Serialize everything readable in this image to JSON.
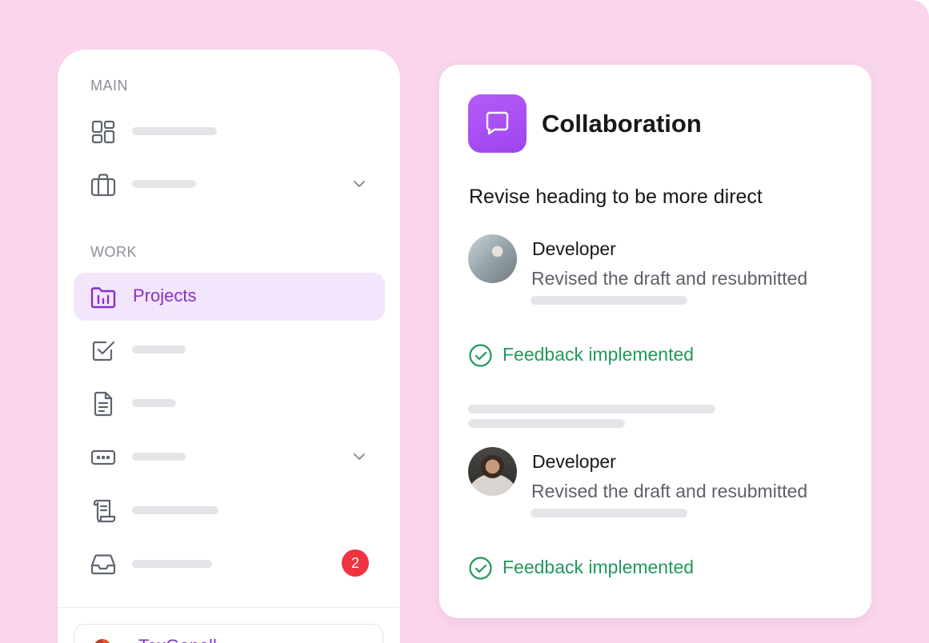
{
  "sidebar": {
    "sections": {
      "main": "MAIN",
      "work": "WORK"
    },
    "items": [
      {
        "icon": "dashboard-grid-icon"
      },
      {
        "icon": "briefcase-icon",
        "has_chevron": true
      },
      {
        "icon": "folder-chart-icon",
        "label": "Projects",
        "active": true
      },
      {
        "icon": "checkbox-icon"
      },
      {
        "icon": "document-icon"
      },
      {
        "icon": "ellipsis-box-icon",
        "has_chevron": true
      },
      {
        "icon": "scroll-icon"
      },
      {
        "icon": "inbox-icon",
        "badge": "2"
      }
    ],
    "org": {
      "name": "TaxGenell"
    }
  },
  "card": {
    "title": "Collaboration",
    "subtitle": "Revise heading to be more direct",
    "entries": [
      {
        "name": "Developer",
        "message": "Revised the draft and resubmitted",
        "status": "Feedback implemented"
      },
      {
        "name": "Developer",
        "message": "Revised the draft and resubmitted",
        "status": "Feedback implemented"
      }
    ]
  },
  "colors": {
    "background": "#f9d6ec",
    "accent": "#8a2fc9",
    "active_bg": "#f2e6fc",
    "success": "#1f9a5a",
    "badge": "#ef3340",
    "icon_gradient": "#a64ff3"
  }
}
